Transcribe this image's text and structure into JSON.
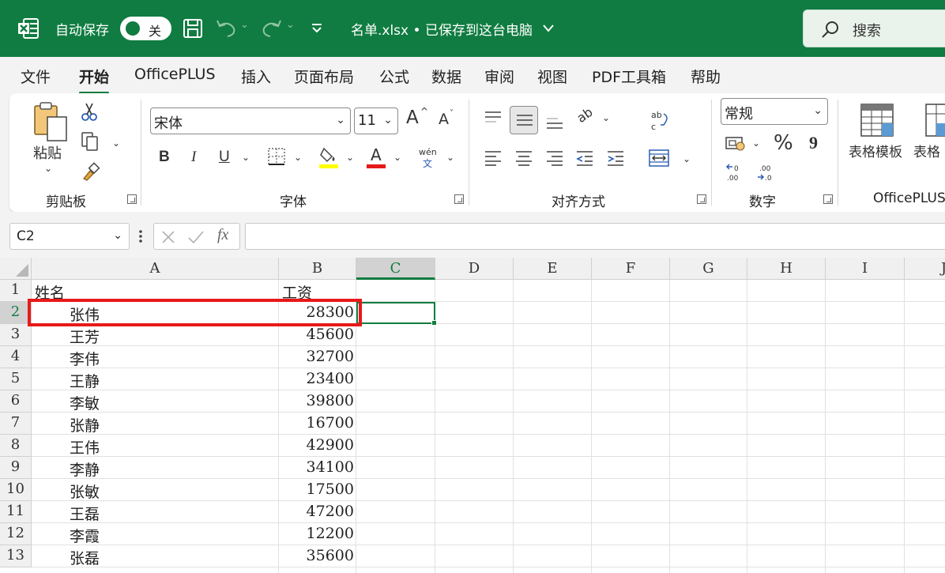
{
  "titlebar": {
    "autosave_label": "自动保存",
    "autosave_state": "关",
    "filename": "名单.xlsx • 已保存到这台电脑",
    "search_label": "搜索",
    "accent_color": "#107c41"
  },
  "tabs": [
    "文件",
    "开始",
    "OfficePLUS",
    "插入",
    "页面布局",
    "公式",
    "数据",
    "审阅",
    "视图",
    "PDF工具箱",
    "帮助"
  ],
  "active_tab": "开始",
  "ribbon": {
    "clipboard": {
      "paste_label": "粘贴",
      "group_label": "剪贴板"
    },
    "font": {
      "font_name": "宋体",
      "font_size": "11",
      "group_label": "字体",
      "wen_label": "wén",
      "wen_char": "文",
      "bold": "B",
      "italic": "I",
      "underline": "U",
      "font_color_glyph": "A",
      "grow": "A",
      "shrink": "A"
    },
    "alignment": {
      "group_label": "对齐方式",
      "orientation_glyph": "ab"
    },
    "number": {
      "format": "常规",
      "group_label": "数字",
      "percent": "%",
      "comma": "9"
    },
    "styles": {
      "table_template_label": "表格模板",
      "table_style_label": "表格",
      "group_label": "OfficePLUS"
    }
  },
  "formula_bar": {
    "name_box": "C2",
    "fx": "fx",
    "content": ""
  },
  "columns": [
    "A",
    "B",
    "C",
    "D",
    "E",
    "F",
    "G",
    "H",
    "I",
    "J"
  ],
  "selected_column": "C",
  "selected_row": "2",
  "rows": [
    {
      "num": "1",
      "a": "姓名",
      "b": "工资"
    },
    {
      "num": "2",
      "a": "张伟",
      "b": "28300"
    },
    {
      "num": "3",
      "a": "王芳",
      "b": "45600"
    },
    {
      "num": "4",
      "a": "李伟",
      "b": "32700"
    },
    {
      "num": "5",
      "a": "王静",
      "b": "23400"
    },
    {
      "num": "6",
      "a": "李敏",
      "b": "39800"
    },
    {
      "num": "7",
      "a": "张静",
      "b": "16700"
    },
    {
      "num": "8",
      "a": "王伟",
      "b": "42900"
    },
    {
      "num": "9",
      "a": "李静",
      "b": "34100"
    },
    {
      "num": "10",
      "a": "张敏",
      "b": "17500"
    },
    {
      "num": "11",
      "a": "王磊",
      "b": "47200"
    },
    {
      "num": "12",
      "a": "李霞",
      "b": "12200"
    },
    {
      "num": "13",
      "a": "张磊",
      "b": "35600"
    }
  ]
}
